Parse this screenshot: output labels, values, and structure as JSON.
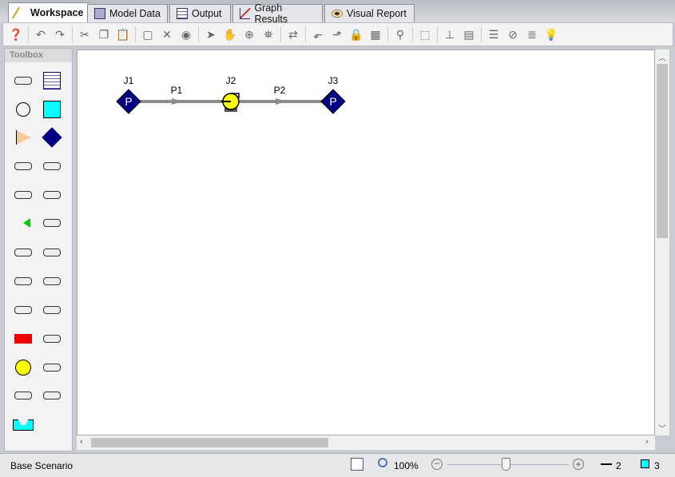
{
  "tabs": [
    {
      "label": "Workspace",
      "icon": "hammer-icon",
      "active": true
    },
    {
      "label": "Model Data",
      "icon": "model-data-icon"
    },
    {
      "label": "Output",
      "icon": "table-icon"
    },
    {
      "label": "Graph Results",
      "icon": "graph-icon"
    },
    {
      "label": "Visual Report",
      "icon": "eye-icon"
    }
  ],
  "toolbar": [
    "help-icon",
    "undo-icon",
    "redo-icon",
    "cut-icon",
    "copy-icon",
    "paste-icon",
    "select-all-icon",
    "delete-icon",
    "globe-icon",
    "pointer-icon",
    "pan-hand-icon",
    "zoom-icon",
    "find-icon",
    "reverse-direction-icon",
    "rotate-left-icon",
    "rotate-right-icon",
    "lock-icon",
    "group-icon",
    "find-binoculars-icon",
    "align-icon",
    "axis-icon",
    "distribute-icon",
    "properties-icon",
    "disable-icon",
    "list-icon",
    "lightbulb-icon"
  ],
  "toolbox": {
    "title": "Toolbox",
    "items": [
      "pipe-tool",
      "annotation-tool",
      "branch-tool",
      "reservoir-tool",
      "assigned-flow-tool",
      "assigned-pressure-tool",
      "bend-tool",
      "elbow-tool",
      "tee-tool",
      "valve-tool",
      "control-valve-tool",
      "check-valve-tool",
      "relief-valve-tool",
      "three-way-valve-tool",
      "area-change-tool",
      "orifice-tool",
      "heat-exchanger-tool",
      "screen-tool",
      "compressor-tool",
      "spray-tool",
      "pump-tool",
      "volume-balance-tool",
      "filter-tool",
      "general-component-tool",
      "dead-end-tool"
    ]
  },
  "model": {
    "junctions": [
      {
        "id": "J1",
        "symbol": "P"
      },
      {
        "id": "J2"
      },
      {
        "id": "J3",
        "symbol": "P"
      }
    ],
    "pipes": [
      {
        "id": "P1"
      },
      {
        "id": "P2"
      }
    ]
  },
  "status": {
    "scenario": "Base Scenario",
    "zoom": "100%",
    "zoom_level_percent": 100,
    "pipes_count": "2",
    "junctions_count": "3"
  },
  "colors": {
    "pressure_node": "#000080",
    "pump": "#ffff00",
    "pipe": "#8c8c8c",
    "junction_count_icon": "#00ffff"
  }
}
